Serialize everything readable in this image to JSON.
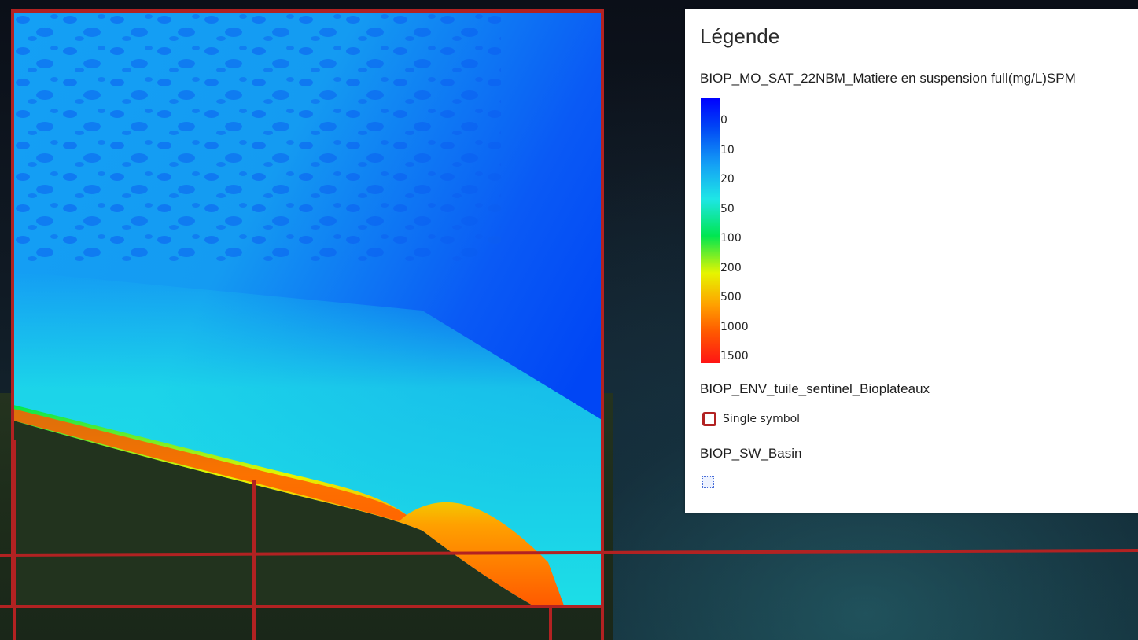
{
  "legend": {
    "title": "Légende",
    "layers": [
      {
        "name": "BIOP_MO_SAT_22NBM_Matiere en suspension full(mg/L)SPM",
        "ramp": {
          "labels": [
            "0",
            "10",
            "20",
            "50",
            "100",
            "200",
            "500",
            "1000",
            "1500"
          ],
          "colors": [
            "#0000ff",
            "#0046f5",
            "#14a0f5",
            "#1ee6e6",
            "#00e650",
            "#e6f500",
            "#ffa000",
            "#ff5a00",
            "#ff1414"
          ]
        }
      },
      {
        "name": "BIOP_ENV_tuile_sentinel_Bioplateaux",
        "symbol_label": "Single symbol",
        "symbol_color": "#b22222"
      },
      {
        "name": "BIOP_SW_Basin",
        "symbol_color": "#4a6ed8"
      }
    ]
  },
  "map": {
    "tile_outline_color": "#b22222"
  }
}
